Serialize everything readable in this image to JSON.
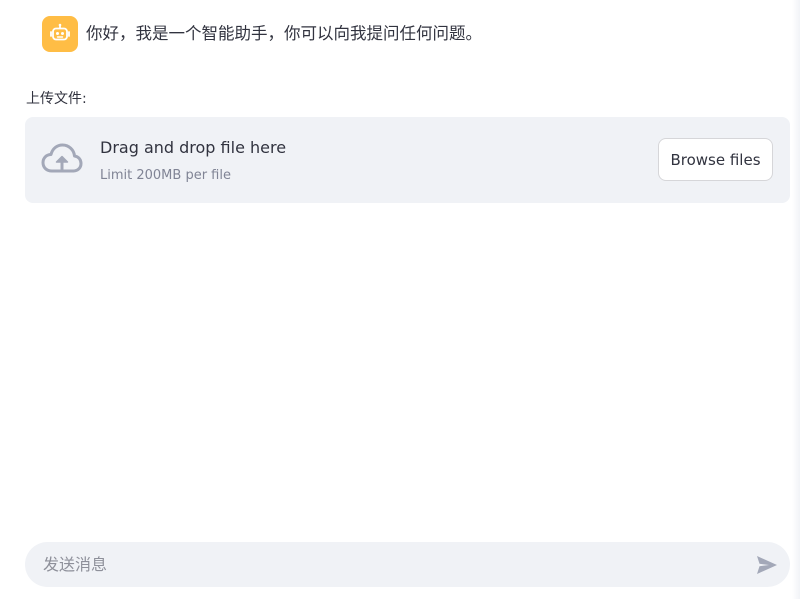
{
  "chat": {
    "messages": [
      {
        "role": "assistant",
        "avatar_icon": "robot-icon",
        "avatar_color": "#ffbd45",
        "text": "你好，我是一个智能助手，你可以向我提问任何问题。"
      }
    ]
  },
  "uploader": {
    "label": "上传文件:",
    "icon": "cloud-upload-icon",
    "dropzone_title": "Drag and drop file here",
    "dropzone_limit": "Limit 200MB per file",
    "browse_label": "Browse files"
  },
  "chat_input": {
    "placeholder": "发送消息",
    "value": "",
    "send_icon": "send-icon"
  },
  "colors": {
    "accent_avatar": "#ffbd45",
    "panel_bg": "#f0f2f6",
    "text_primary": "#31333f",
    "text_muted": "#808495",
    "icon_muted": "#a3a8b8"
  }
}
